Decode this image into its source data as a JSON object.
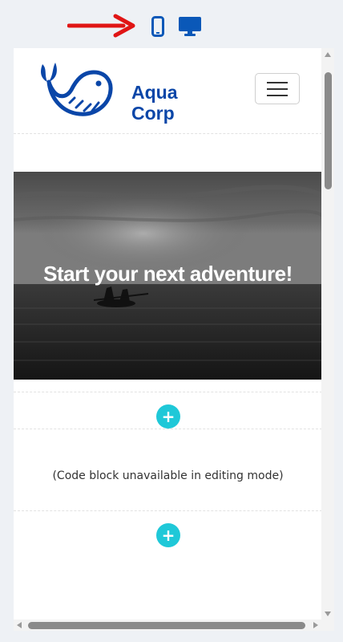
{
  "toolbar": {
    "arrow_color": "#e01515",
    "mobile_icon": "mobile-phone-icon",
    "desktop_icon": "desktop-monitor-icon",
    "icon_color": "#0a58b8"
  },
  "site": {
    "logo": {
      "line1": "Aqua",
      "line2": "Corp",
      "icon": "whale-icon",
      "color": "#0a46a8"
    },
    "menu_icon": "hamburger-menu-icon",
    "hero": {
      "title": "Start your next adventure!"
    },
    "add_block_icon": "plus-icon",
    "add_color": "#1fc8d8",
    "code_block": {
      "message": "(Code block unavailable in editing mode)"
    }
  }
}
